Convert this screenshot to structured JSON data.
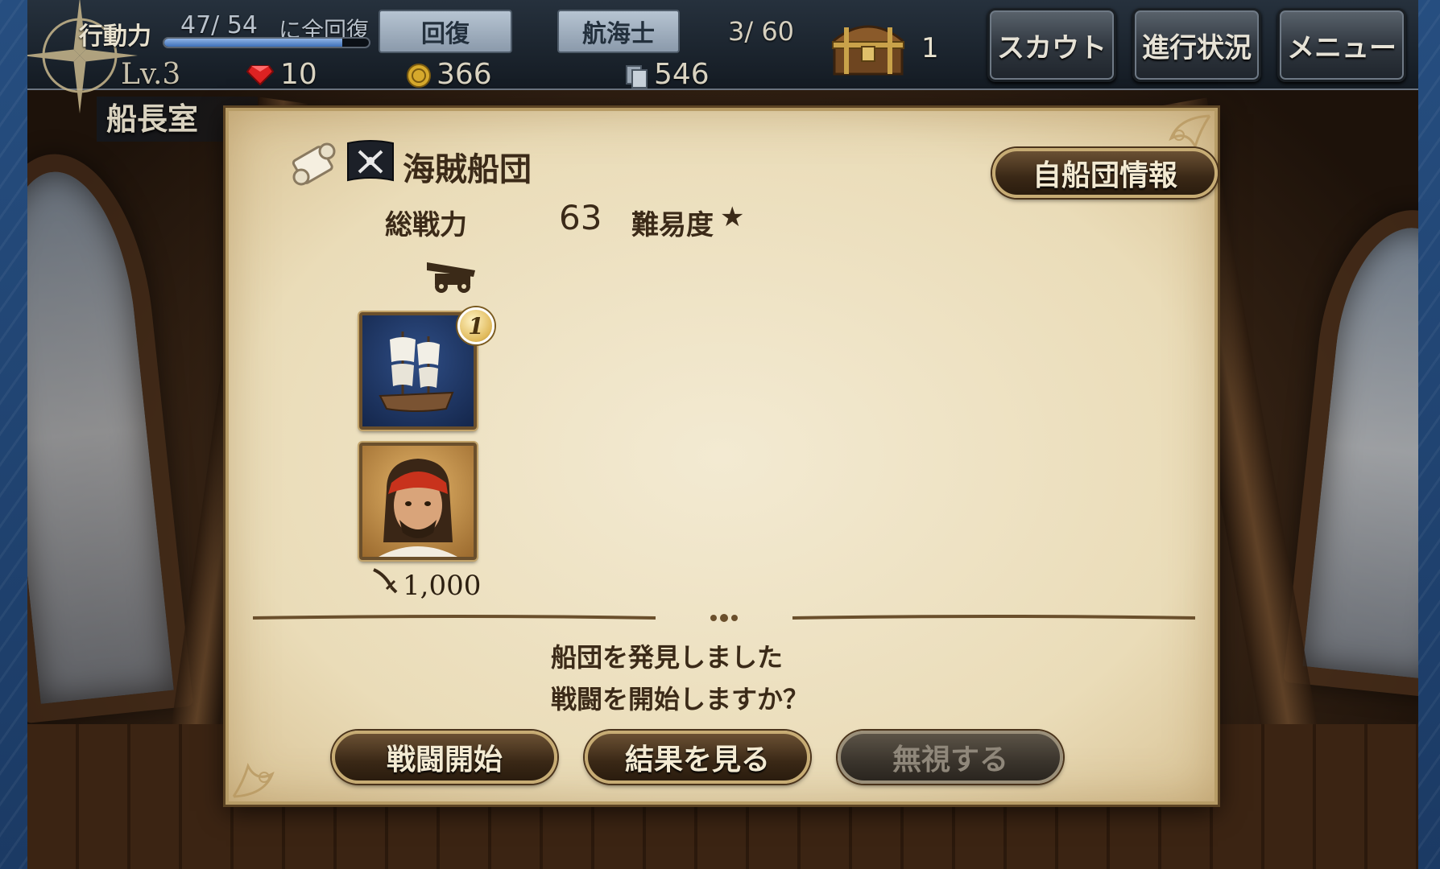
{
  "topbar": {
    "stamina_label": "行動力",
    "stamina_value": "47/ 54",
    "stamina_fraction": 0.87,
    "stamina_note": "に全回復",
    "recover_button": "回復",
    "navigator_button": "航海士",
    "navigator_count": "3/ 60",
    "chest_count": "1",
    "scout_button": "スカウト",
    "progress_button": "進行状況",
    "menu_button": "メニュー",
    "level": "Lv.3",
    "gems": "10",
    "coins": "366",
    "cards": "546"
  },
  "room": {
    "title": "船長室"
  },
  "dialog": {
    "fleet_name": "海賊船団",
    "own_fleet_button": "自船団情報",
    "power_label": "総戦力",
    "power_value": "63",
    "difficulty_label": "難易度",
    "difficulty_stars": "★",
    "ship_badge": "1",
    "reward_value": "1,000",
    "message_line1": "船団を発見しました",
    "message_line2": "戦闘を開始しますか？",
    "battle_button": "戦闘開始",
    "result_button": "結果を見る",
    "ignore_button": "無視する"
  },
  "colors": {
    "parchment": "#eadcb8",
    "button_brown": "#3a2816",
    "button_border": "#c7ac74",
    "topbar_dark": "#141b23"
  },
  "icons": {
    "compass": "compass-rose-icon",
    "chest": "treasure-chest-icon",
    "gem": "ruby-gem-icon",
    "coin": "gold-coin-icon",
    "card": "card-stack-icon",
    "scroll": "scroll-icon",
    "flag": "pirate-flag-icon",
    "cannon": "cannon-icon",
    "sword": "cutlass-icon"
  }
}
